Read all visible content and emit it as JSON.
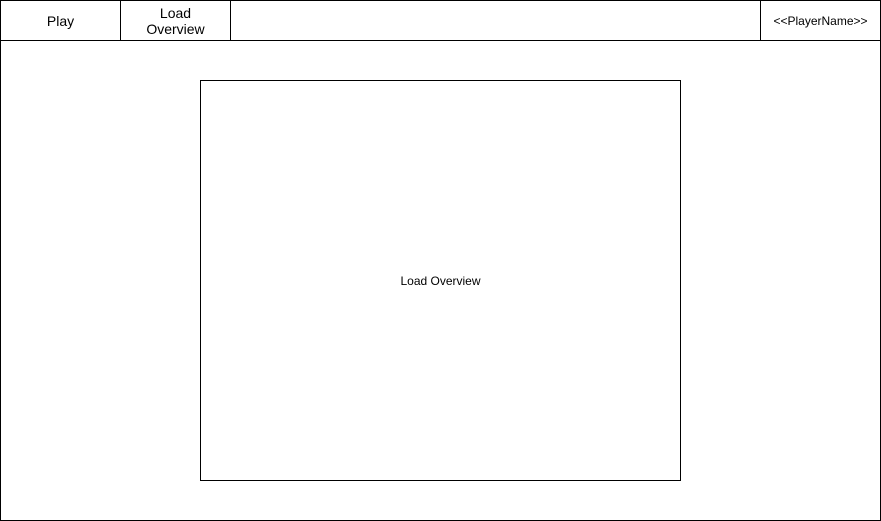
{
  "nav": {
    "play_label": "Play",
    "load_overview_line1": "Load",
    "load_overview_line2": "Overview"
  },
  "header": {
    "player_name": "<<PlayerName>>"
  },
  "main": {
    "panel_label": "Load Overview"
  },
  "colors": {
    "border": "#000000",
    "background": "#ffffff",
    "text": "#000000"
  }
}
